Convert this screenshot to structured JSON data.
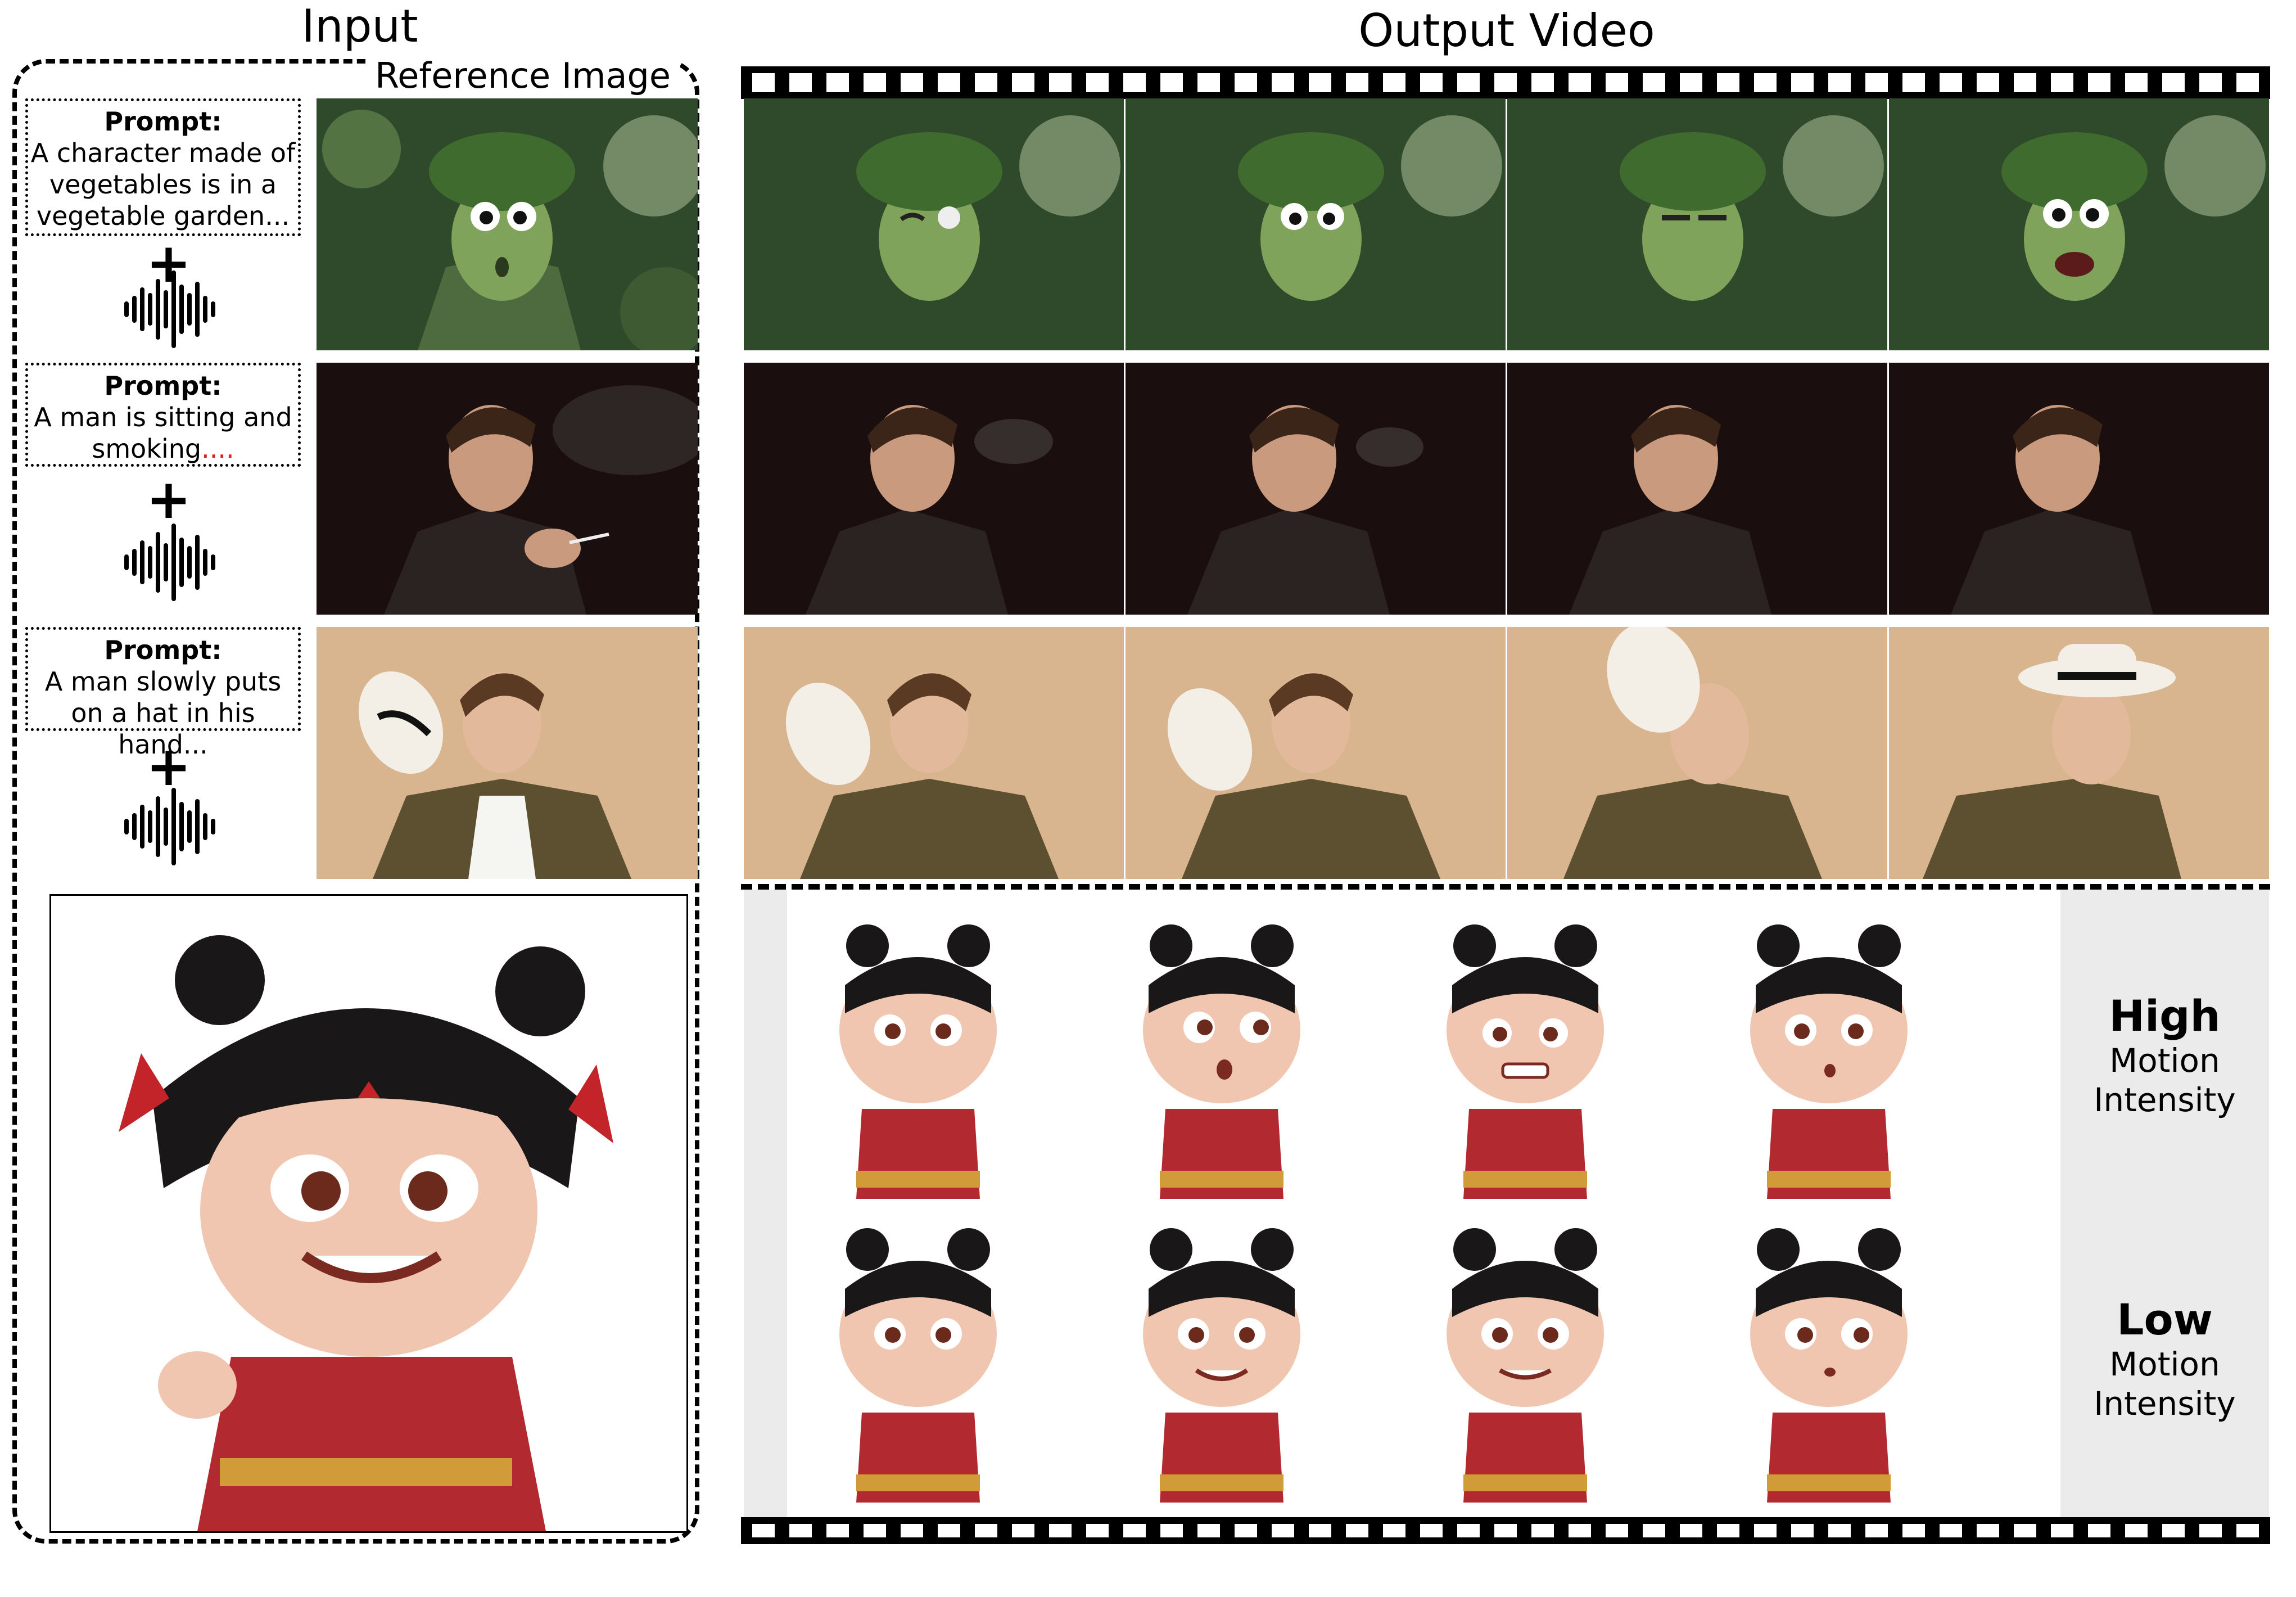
{
  "header": {
    "input_title": "Input",
    "reference_image_label": "Reference Image",
    "output_title": "Output Video"
  },
  "rows": [
    {
      "prompt_label": "Prompt:",
      "prompt_text": "A character made of vegetables is in a vegetable garden...",
      "plus": "+"
    },
    {
      "prompt_label": "Prompt:",
      "prompt_text": "A man is sitting and smoking",
      "prompt_ellipsis": "....",
      "plus": "+"
    },
    {
      "prompt_label": "Prompt:",
      "prompt_text": "A man slowly puts on a hat in his hand...",
      "plus": "+"
    }
  ],
  "intensity": {
    "high_title": "High",
    "high_sub1": "Motion",
    "high_sub2": "Intensity",
    "low_title": "Low",
    "low_sub1": "Motion",
    "low_sub2": "Intensity"
  },
  "colors": {
    "veg_bg": "#2f4a2a",
    "veg_char": "#7fa35a",
    "smoke_bg": "#1a0f0e",
    "jacket": "#2a2322",
    "skin": "#c99a7d",
    "hat_bg": "#d8b58e",
    "olive": "#5d5030",
    "girl_red": "#c3242a",
    "hair": "#1a1718",
    "gray_panel": "#ebebeb"
  }
}
